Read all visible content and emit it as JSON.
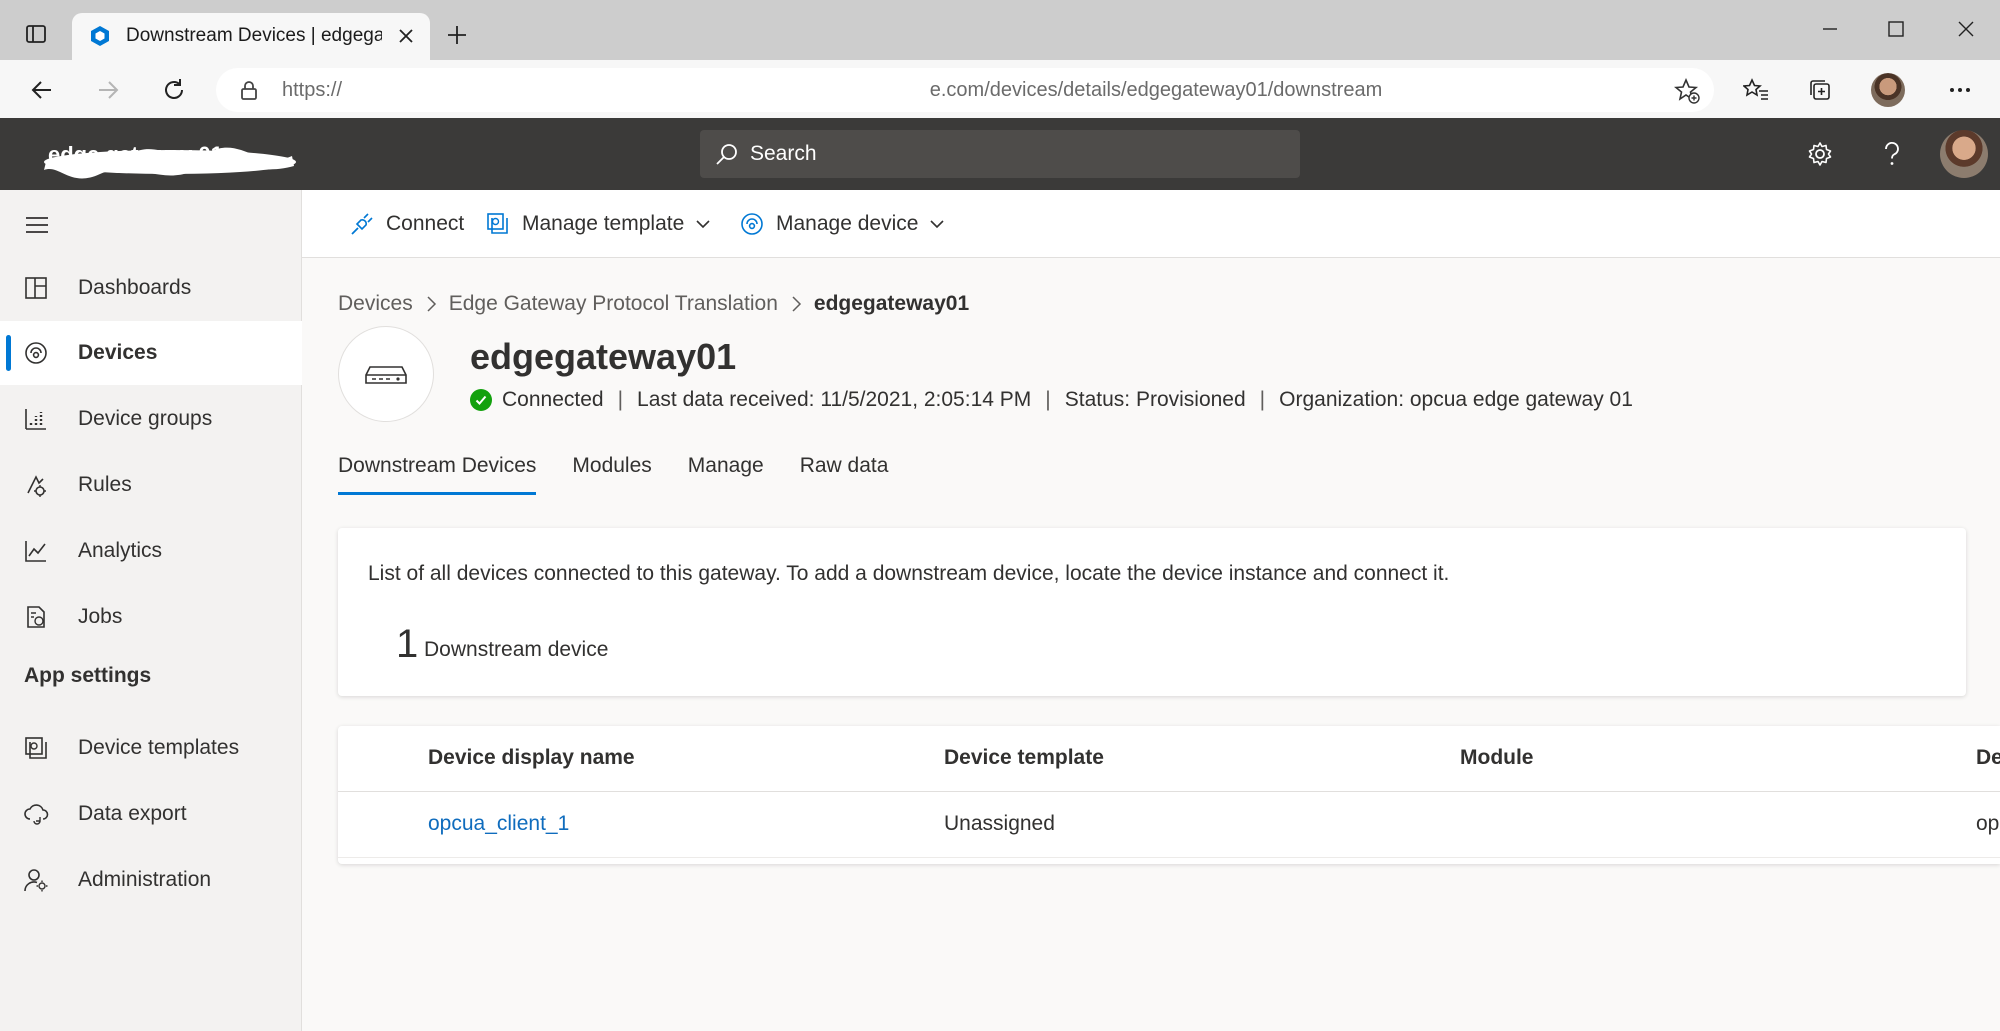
{
  "browser": {
    "tab_title": "Downstream Devices | edgegateway",
    "url_prefix": "https://",
    "url_visible": "e.com/devices/details/edgegateway01/downstream"
  },
  "app": {
    "name": "edge gateway 01",
    "search_placeholder": "Search"
  },
  "commands": {
    "connect": "Connect",
    "manage_template": "Manage template",
    "manage_device": "Manage device"
  },
  "sidebar": {
    "items": [
      {
        "label": "Dashboards",
        "icon": "dashboard-icon"
      },
      {
        "label": "Devices",
        "icon": "devices-icon"
      },
      {
        "label": "Device groups",
        "icon": "device-groups-icon"
      },
      {
        "label": "Rules",
        "icon": "rules-icon"
      },
      {
        "label": "Analytics",
        "icon": "analytics-icon"
      },
      {
        "label": "Jobs",
        "icon": "jobs-icon"
      }
    ],
    "section_title": "App settings",
    "settings_items": [
      {
        "label": "Device templates",
        "icon": "device-templates-icon"
      },
      {
        "label": "Data export",
        "icon": "data-export-icon"
      },
      {
        "label": "Administration",
        "icon": "administration-icon"
      }
    ]
  },
  "breadcrumb": {
    "items": [
      "Devices",
      "Edge Gateway Protocol Translation",
      "edgegateway01"
    ]
  },
  "device": {
    "name": "edgegateway01",
    "connection": "Connected",
    "last_data": "Last data received: 11/5/2021, 2:05:14 PM",
    "status": "Status: Provisioned",
    "organization": "Organization: opcua edge gateway 01"
  },
  "tabs": [
    "Downstream Devices",
    "Modules",
    "Manage",
    "Raw data"
  ],
  "summary": {
    "description": "List of all devices connected to this gateway. To add a downstream device, locate the device instance and connect it.",
    "count": "1",
    "count_label": "Downstream device"
  },
  "table": {
    "columns": [
      "Device display name",
      "Device template",
      "Module",
      "De"
    ],
    "rows": [
      {
        "name": "opcua_client_1",
        "template": "Unassigned",
        "module": "",
        "extra": "op"
      }
    ]
  },
  "colors": {
    "accent": "#0078d4",
    "header_bg": "#3b3a39",
    "connected": "#13a10e"
  }
}
